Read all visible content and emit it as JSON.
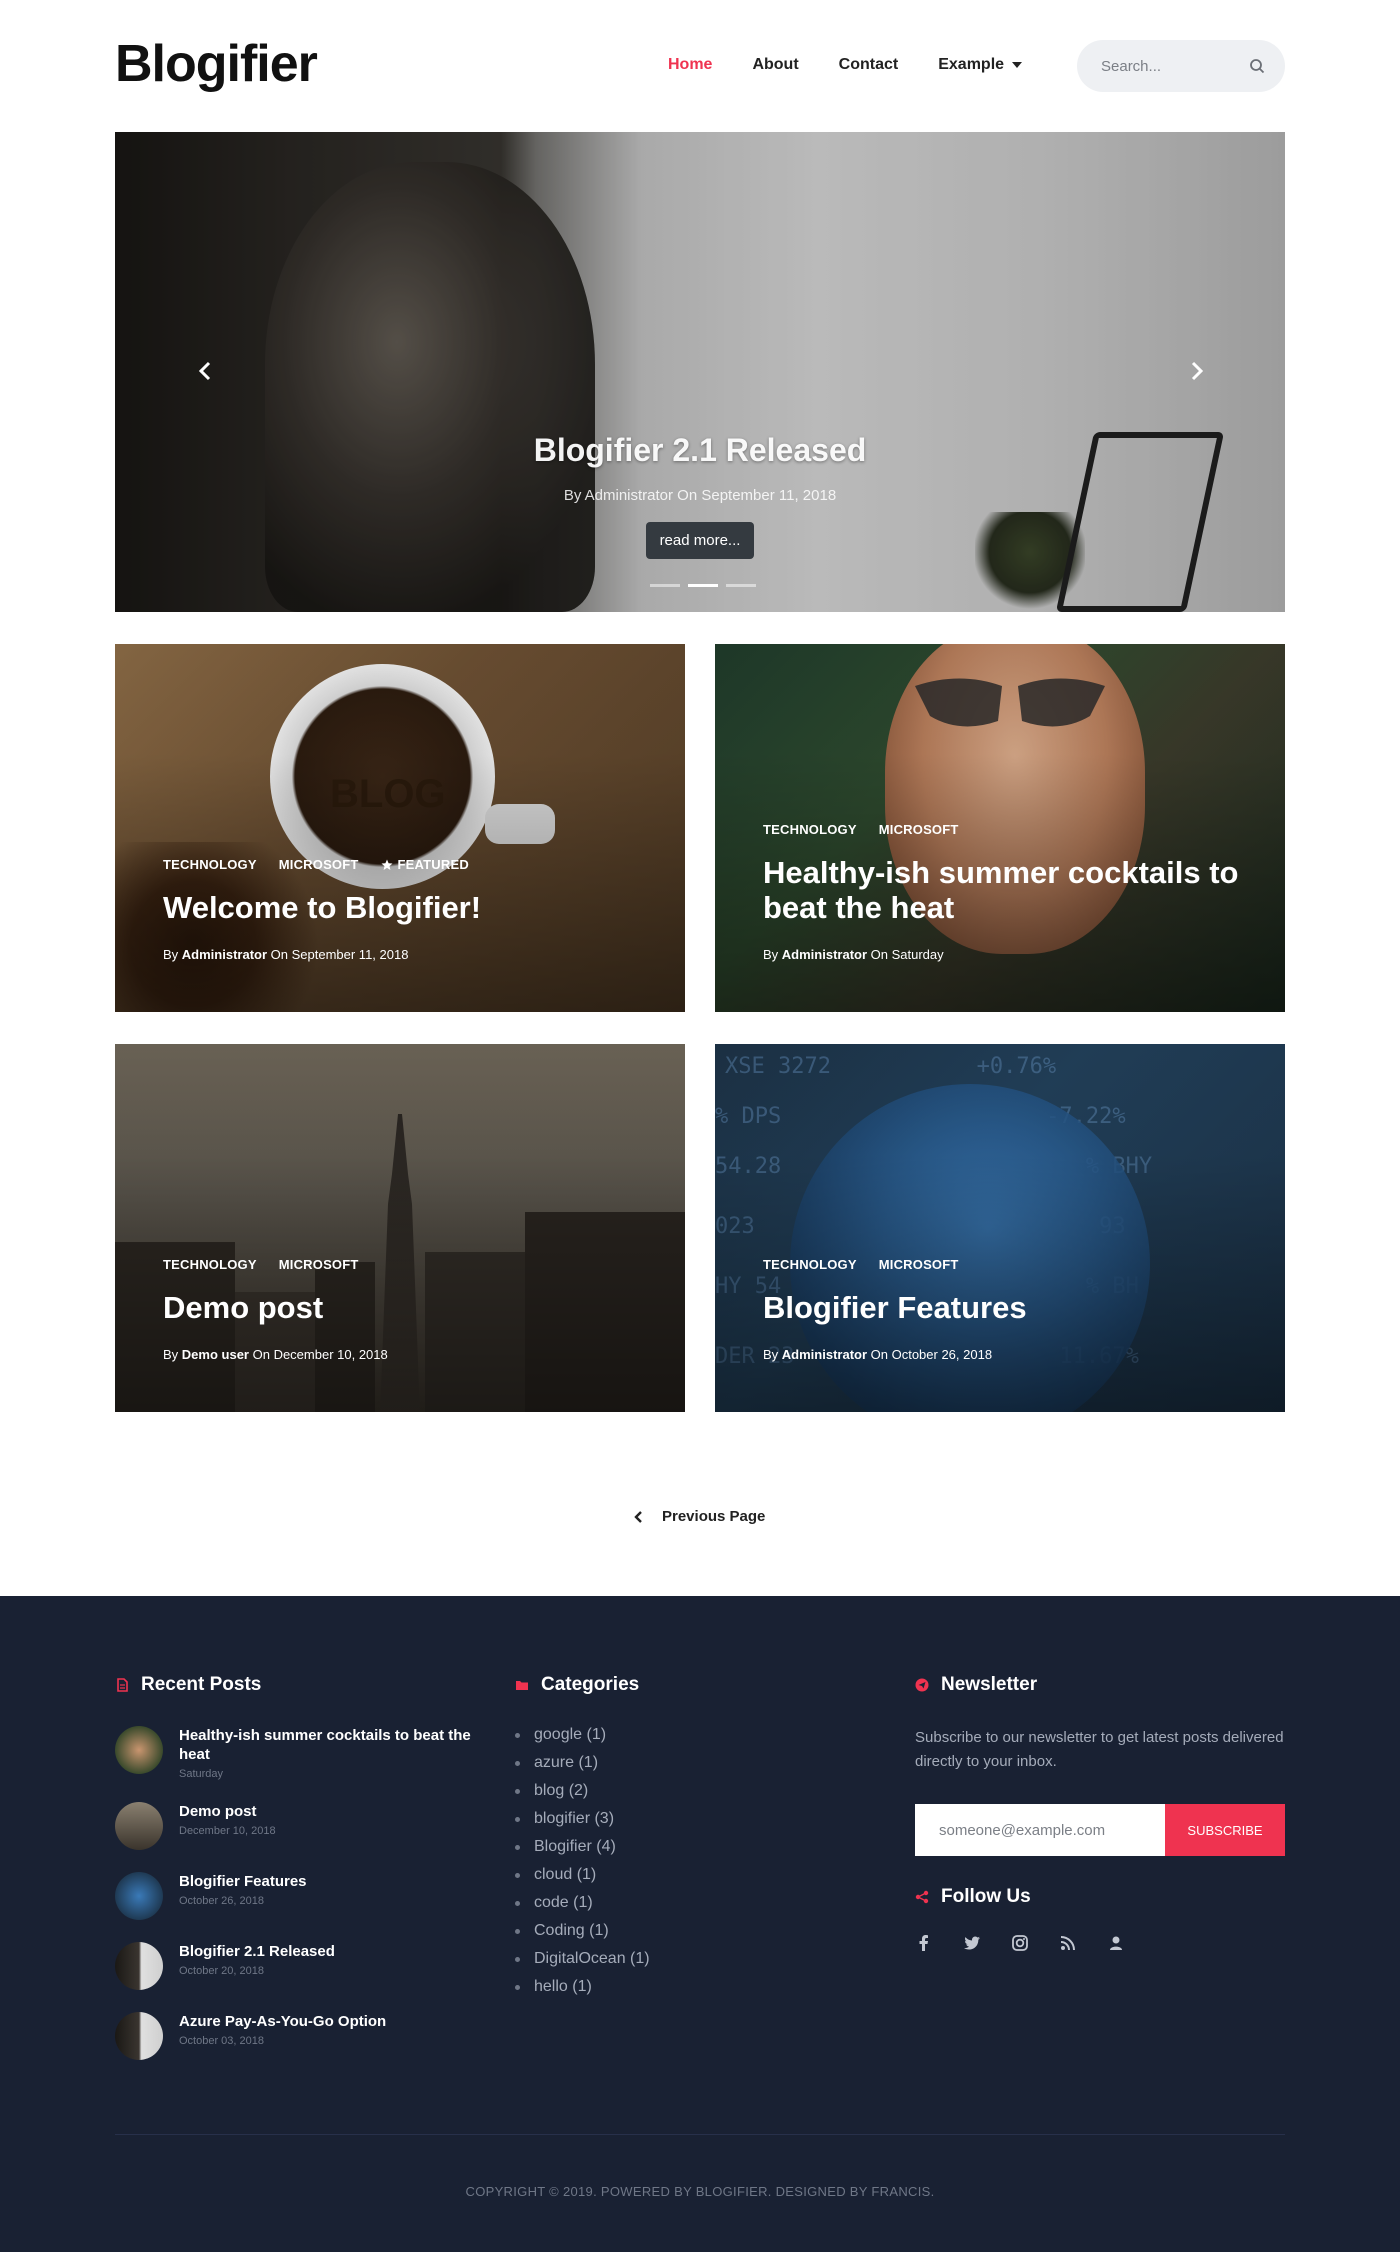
{
  "brand": {
    "logo": "Blogifier"
  },
  "nav": {
    "items": [
      {
        "label": "Home",
        "active": true
      },
      {
        "label": "About"
      },
      {
        "label": "Contact"
      },
      {
        "label": "Example",
        "dropdown": true
      }
    ]
  },
  "search": {
    "placeholder": "Search..."
  },
  "hero": {
    "title": "Blogifier 2.1 Released",
    "meta": "By Administrator On September 11, 2018",
    "button": "read more...",
    "slides": 3,
    "active_slide": 2
  },
  "posts": [
    {
      "cats": [
        "TECHNOLOGY",
        "MICROSOFT"
      ],
      "featured": "FEATURED",
      "title": "Welcome to Blogifier!",
      "by": "By ",
      "author": "Administrator",
      "on": " On September 11, 2018"
    },
    {
      "cats": [
        "TECHNOLOGY",
        "MICROSOFT"
      ],
      "title_line1": "Healthy-ish summer cocktails to",
      "title_line2": "beat the heat",
      "by": "By ",
      "author": "Administrator",
      "on": " On Saturday"
    },
    {
      "cats": [
        "TECHNOLOGY",
        "MICROSOFT"
      ],
      "title": "Demo post",
      "by": "By ",
      "author": "Demo user",
      "on": " On December 10, 2018"
    },
    {
      "cats": [
        "TECHNOLOGY",
        "MICROSOFT"
      ],
      "title": "Blogifier Features",
      "by": "By ",
      "author": "Administrator",
      "on": " On October 26, 2018"
    }
  ],
  "pager": {
    "label": "Previous Page"
  },
  "footer": {
    "recent_title": "Recent Posts",
    "recent": [
      {
        "title": "Healthy-ish summer cocktails to beat the heat",
        "date": "Saturday"
      },
      {
        "title": "Demo post",
        "date": "December 10, 2018"
      },
      {
        "title": "Blogifier Features",
        "date": "October 26, 2018"
      },
      {
        "title": "Blogifier 2.1 Released",
        "date": "October 20, 2018"
      },
      {
        "title": "Azure Pay-As-You-Go Option",
        "date": "October 03, 2018"
      }
    ],
    "categories_title": "Categories",
    "categories": [
      "google (1)",
      "azure (1)",
      "blog (2)",
      "blogifier (3)",
      "Blogifier (4)",
      "cloud (1)",
      "code (1)",
      "Coding (1)",
      "DigitalOcean (1)",
      "hello (1)"
    ],
    "newsletter_title": "Newsletter",
    "newsletter_text": "Subscribe to our newsletter to get latest posts delivered directly to your inbox.",
    "email_placeholder": "someone@example.com",
    "subscribe": "SUBSCRIBE",
    "follow_title": "Follow Us",
    "social": [
      "facebook-icon",
      "twitter-icon",
      "instagram-icon",
      "rss-icon",
      "user-icon"
    ],
    "copyright": "COPYRIGHT © 2019. POWERED BY BLOGIFIER. DESIGNED BY FRANCIS."
  },
  "colors": {
    "accent": "#ef3350",
    "footer_bg": "#192133"
  }
}
